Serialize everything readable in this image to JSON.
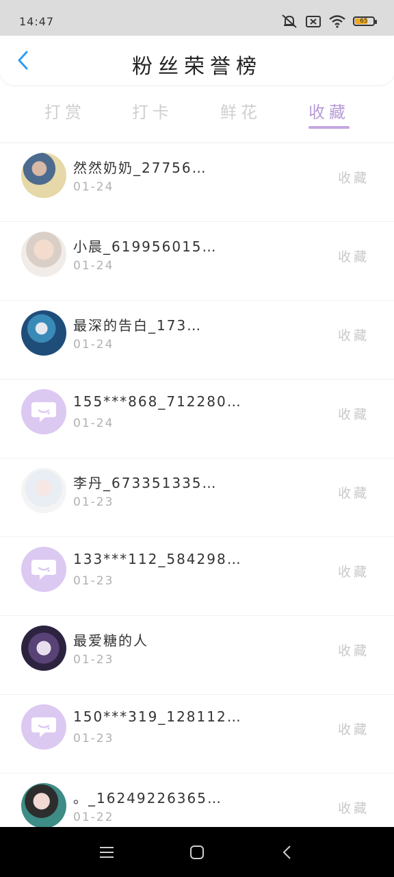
{
  "status_bar": {
    "time": "14:47",
    "battery": "65",
    "battery_fraction": 0.65
  },
  "header": {
    "title": "粉丝荣誉榜",
    "back_icon": "chevron-left-icon"
  },
  "tabs": [
    {
      "label": "打赏"
    },
    {
      "label": "打卡"
    },
    {
      "label": "鲜花"
    },
    {
      "label": "收藏"
    }
  ],
  "active_tab": "收藏",
  "list": [
    {
      "name": "然然奶奶_27756…",
      "date": "01-24",
      "action": "收藏"
    },
    {
      "name": "小晨_619956015…",
      "date": "01-24",
      "action": "收藏"
    },
    {
      "name": "最深的告白_173…",
      "date": "01-24",
      "action": "收藏"
    },
    {
      "name": "155***868_712280…",
      "date": "01-24",
      "action": "收藏"
    },
    {
      "name": "李丹_673351335…",
      "date": "01-23",
      "action": "收藏"
    },
    {
      "name": "133***112_584298…",
      "date": "01-23",
      "action": "收藏"
    },
    {
      "name": "最爱糖的人",
      "date": "01-23",
      "action": "收藏"
    },
    {
      "name": "150***319_128112…",
      "date": "01-23",
      "action": "收藏"
    },
    {
      "name": "。_16249226365…",
      "date": "01-22",
      "action": "收藏"
    }
  ],
  "colors": {
    "accent": "#b79bd6",
    "back_arrow": "#2d9cf0",
    "default_avatar": "#dcc9f2"
  }
}
